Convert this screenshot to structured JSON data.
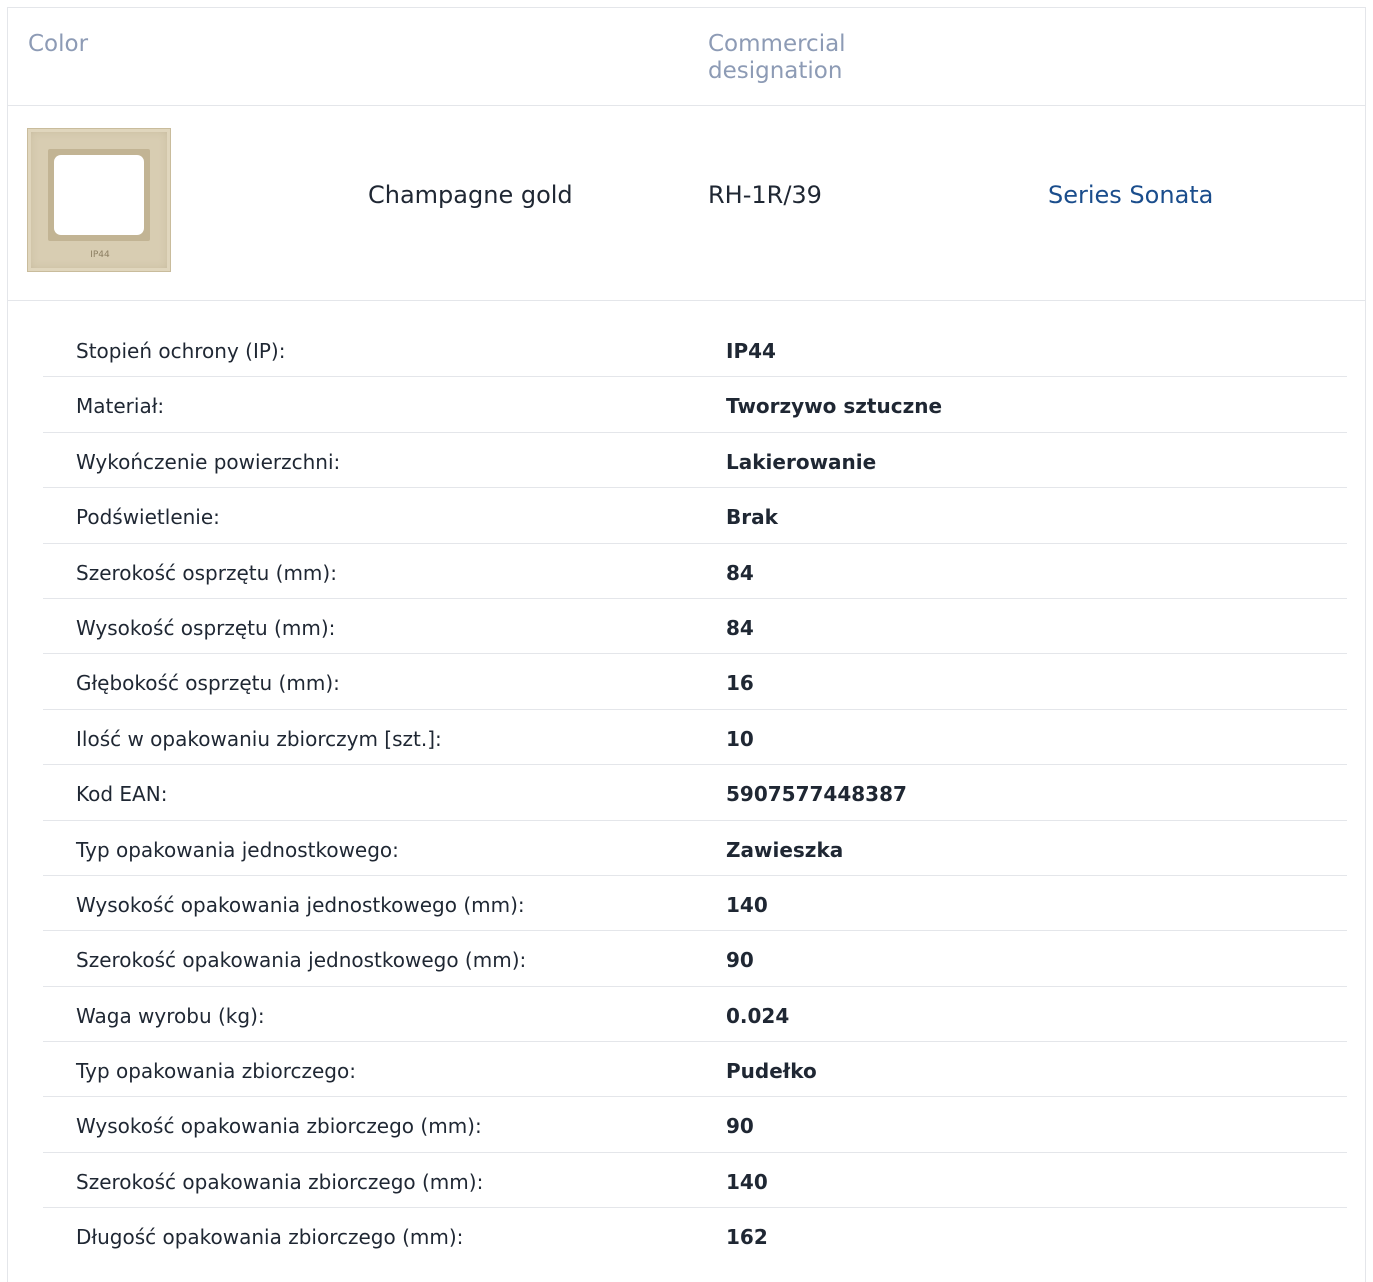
{
  "header": {
    "color_label": "Color",
    "designation_label": "Commercial designation"
  },
  "product": {
    "thumbnail_text": "IP44",
    "color_name": "Champagne gold",
    "code": "RH-1R/39",
    "series_link": "Series Sonata",
    "thumbnail_color": "#d8cdb2"
  },
  "specs": [
    {
      "label": "Stopień ochrony (IP):",
      "value": "IP44"
    },
    {
      "label": "Materiał:",
      "value": "Tworzywo sztuczne"
    },
    {
      "label": "Wykończenie powierzchni:",
      "value": "Lakierowanie"
    },
    {
      "label": "Podświetlenie:",
      "value": "Brak"
    },
    {
      "label": "Szerokość osprzętu (mm):",
      "value": "84"
    },
    {
      "label": "Wysokość osprzętu (mm):",
      "value": "84"
    },
    {
      "label": "Głębokość osprzętu (mm):",
      "value": "16"
    },
    {
      "label": "Ilość w opakowaniu zbiorczym [szt.]:",
      "value": "10"
    },
    {
      "label": "Kod EAN:",
      "value": "5907577448387"
    },
    {
      "label": "Typ opakowania jednostkowego:",
      "value": "Zawieszka"
    },
    {
      "label": "Wysokość opakowania jednostkowego (mm):",
      "value": "140"
    },
    {
      "label": "Szerokość opakowania jednostkowego (mm):",
      "value": "90"
    },
    {
      "label": "Waga wyrobu (kg):",
      "value": "0.024"
    },
    {
      "label": "Typ opakowania zbiorczego:",
      "value": "Pudełko"
    },
    {
      "label": "Wysokość opakowania zbiorczego (mm):",
      "value": "90"
    },
    {
      "label": "Szerokość opakowania zbiorczego (mm):",
      "value": "140"
    },
    {
      "label": "Długość opakowania zbiorczego (mm):",
      "value": "162"
    }
  ]
}
